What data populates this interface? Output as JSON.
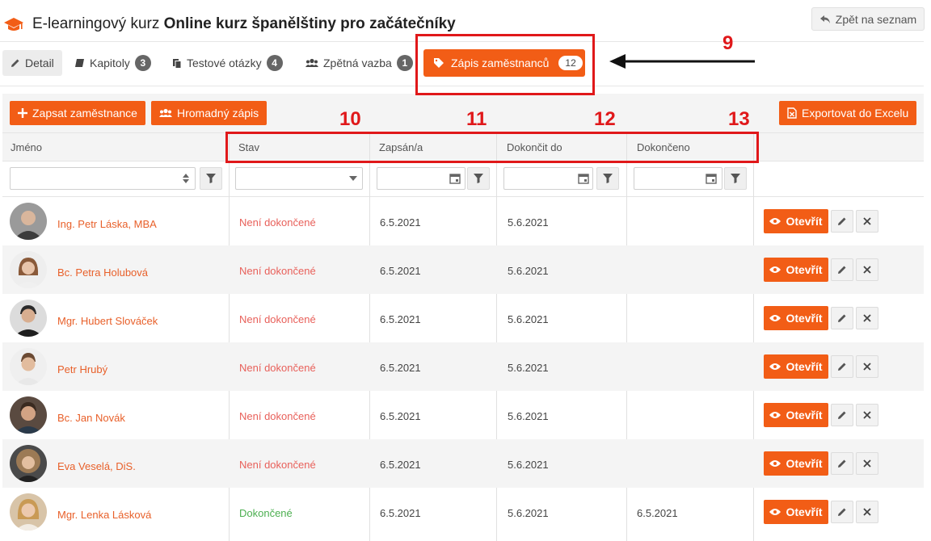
{
  "header": {
    "title_prefix": "E-learningový kurz ",
    "title_course": "Online kurz španělštiny pro začátečníky",
    "back_label": "Zpět na seznam"
  },
  "tabs": [
    {
      "label": "Detail",
      "icon": "pencil-icon"
    },
    {
      "label": "Kapitoly",
      "icon": "book-icon",
      "badge": "3"
    },
    {
      "label": "Testové otázky",
      "icon": "copy-icon",
      "badge": "4"
    },
    {
      "label": "Zpětná vazba",
      "icon": "users-icon",
      "badge": "1"
    },
    {
      "label": "Zápis zaměstnanců",
      "icon": "tag-icon",
      "badge": "12"
    }
  ],
  "toolbar": {
    "enroll_label": "Zapsat zaměstnance",
    "bulk_label": "Hromadný zápis",
    "export_label": "Exportovat do Excelu"
  },
  "table": {
    "columns": [
      "Jméno",
      "Stav",
      "Zapsán/a",
      "Dokončit do",
      "Dokončeno"
    ],
    "open_label": "Otevřít",
    "rows": [
      {
        "name": "Ing. Petr Láska, MBA",
        "status": "Není dokončené",
        "enrolled": "6.5.2021",
        "due": "5.6.2021",
        "completed": ""
      },
      {
        "name": "Bc. Petra Holubová",
        "status": "Není dokončené",
        "enrolled": "6.5.2021",
        "due": "5.6.2021",
        "completed": ""
      },
      {
        "name": "Mgr. Hubert Slováček",
        "status": "Není dokončené",
        "enrolled": "6.5.2021",
        "due": "5.6.2021",
        "completed": ""
      },
      {
        "name": "Petr Hrubý",
        "status": "Není dokončené",
        "enrolled": "6.5.2021",
        "due": "5.6.2021",
        "completed": ""
      },
      {
        "name": "Bc. Jan Novák",
        "status": "Není dokončené",
        "enrolled": "6.5.2021",
        "due": "5.6.2021",
        "completed": ""
      },
      {
        "name": "Eva Veselá, DiS.",
        "status": "Není dokončené",
        "enrolled": "6.5.2021",
        "due": "5.6.2021",
        "completed": ""
      },
      {
        "name": "Mgr. Lenka Lásková",
        "status": "Dokončené",
        "enrolled": "6.5.2021",
        "due": "5.6.2021",
        "completed": "6.5.2021"
      }
    ]
  },
  "annotations": [
    "9",
    "10",
    "11",
    "12",
    "13"
  ],
  "colors": {
    "accent": "#f25d16",
    "annotation": "#e0181a",
    "status_open": "#e8605a",
    "status_done": "#4caf50"
  }
}
